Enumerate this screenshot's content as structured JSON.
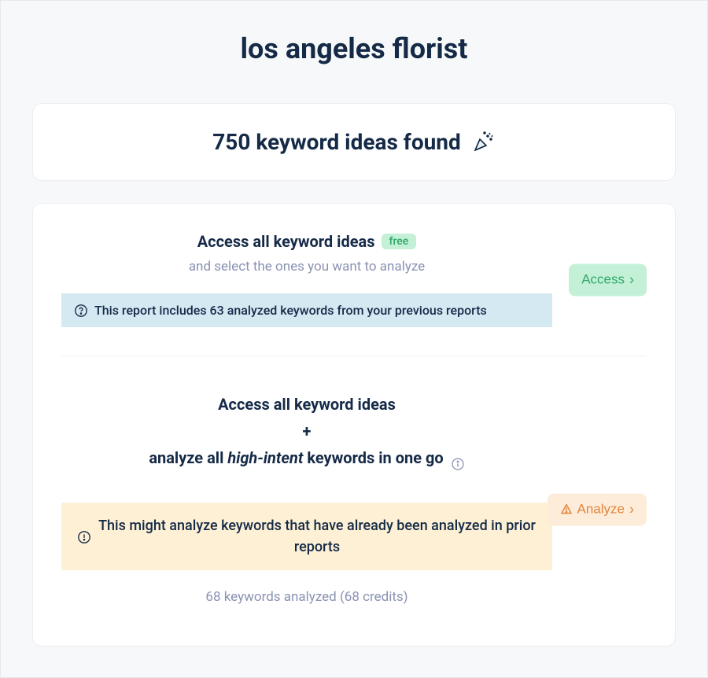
{
  "page_title": "los angeles florist",
  "results": {
    "count_text": "750 keyword ideas found"
  },
  "option_access": {
    "title": "Access all keyword ideas",
    "badge": "free",
    "subtitle": "and select the ones you want to analyze",
    "notice": "This report includes 63 analyzed keywords from your previous reports",
    "button_label": "Access"
  },
  "option_analyze": {
    "line1": "Access all keyword ideas",
    "plus": "+",
    "line2_pre": "analyze all ",
    "line2_em": "high-intent",
    "line2_post": " keywords in one go",
    "notice": "This might analyze keywords that have already been analyzed in prior reports",
    "button_label": "Analyze",
    "credits_text": "68 keywords analyzed (68 credits)"
  }
}
